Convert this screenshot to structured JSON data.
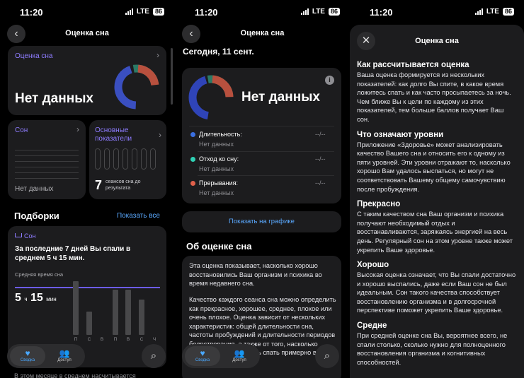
{
  "status": {
    "time": "11:20",
    "network": "LTE",
    "battery": "86"
  },
  "screen1": {
    "nav_title": "Оценка сна",
    "score_card": {
      "title": "Оценка сна",
      "value": "Нет данных"
    },
    "sleep_card": {
      "title": "Сон",
      "value": "Нет данных"
    },
    "vitals_card": {
      "title": "Основные показатели",
      "count": "7",
      "caption": "сеансов сна до результата"
    },
    "highlights": {
      "heading": "Подборки",
      "show_all": "Показать все"
    },
    "highlight_card": {
      "tag": "Сон",
      "text": "За последние 7 дней Вы спали в среднем 5 ч 15 мин.",
      "avg_label": "Средняя время сна",
      "avg_h": "5",
      "avg_h_unit": "ч",
      "avg_m": "15",
      "avg_m_unit": "мин",
      "days": [
        "П",
        "С",
        "В",
        "П",
        "В",
        "С",
        "Ч"
      ],
      "bar_levels": [
        0.86,
        0.38,
        0,
        0.73,
        0.73,
        0.57,
        0
      ]
    },
    "bottom_text": "В этом месяце в среднем насчитывается"
  },
  "screen2": {
    "nav_title": "Оценка сна",
    "date": "Сегодня, 11 сент.",
    "value": "Нет данных",
    "info_icon": "info-icon",
    "metrics": [
      {
        "label": "Длительность:",
        "value": "--/--",
        "status": "Нет данных",
        "color": "#3a6fe0"
      },
      {
        "label": "Отход ко сну:",
        "value": "--/--",
        "status": "Нет данных",
        "color": "#2fd2b5"
      },
      {
        "label": "Прерывания:",
        "value": "--/--",
        "status": "Нет данных",
        "color": "#e0604a"
      }
    ],
    "chart_button": "Показать на графике",
    "about_heading": "Об оценке сна",
    "about_p1": "Эта оценка показывает, насколько хорошо восстановились Ваш организм и психика во время недавнего сна.",
    "about_p2": "Качество каждого сеанса сна можно определить как прекрасное, хорошее, среднее, плохое или очень плохое. Оценка зависит от нескольких характеристик: общей длительности сна, частоты пробуждений и длительности периодов бодрствования, а также от того, насколько регулярно Вы ложитесь спать примерно в одно и то же время."
  },
  "screen3": {
    "nav_title": "Оценка сна",
    "sections": [
      {
        "title": "Как рассчитывается оценка",
        "body": "Ваша оценка формируется из нескольких показателей: как долго Вы спите, в какое время ложитесь спать и как часто просыпаетесь за ночь. Чем ближе Вы к цели по каждому из этих показателей, тем больше баллов получает Ваш сон."
      },
      {
        "title": "Что означают уровни",
        "body": "Приложение «Здоровье» может анализировать качество Вашего сна и относить его к одному из пяти уровней. Эти уровни отражают то, насколько хорошо Вам удалось выспаться, но могут не соответствовать Вашему общему самочувствию после пробуждения."
      },
      {
        "title": "Прекрасно",
        "body": "С таким качеством сна Ваш организм и психика получают необходимый отдых и восстанавливаются, заряжаясь энергией на весь день. Регулярный сон на этом уровне также может укрепить Ваше здоровье."
      },
      {
        "title": "Хорошо",
        "body": "Высокая оценка означает, что Вы спали достаточно и хорошо выспались, даже если Ваш сон не был идеальным. Сон такого качества способствует восстановлению организма и в долгосрочной перспективе поможет укрепить Ваше здоровье."
      },
      {
        "title": "Средне",
        "body": "При средней оценке сна Вы, вероятнее всего, не спали столько, сколько нужно для полноценного восстановления организма и когнитивных способностей."
      }
    ]
  },
  "tabbar": {
    "summary": "Сводка",
    "sharing": "Доступ"
  }
}
